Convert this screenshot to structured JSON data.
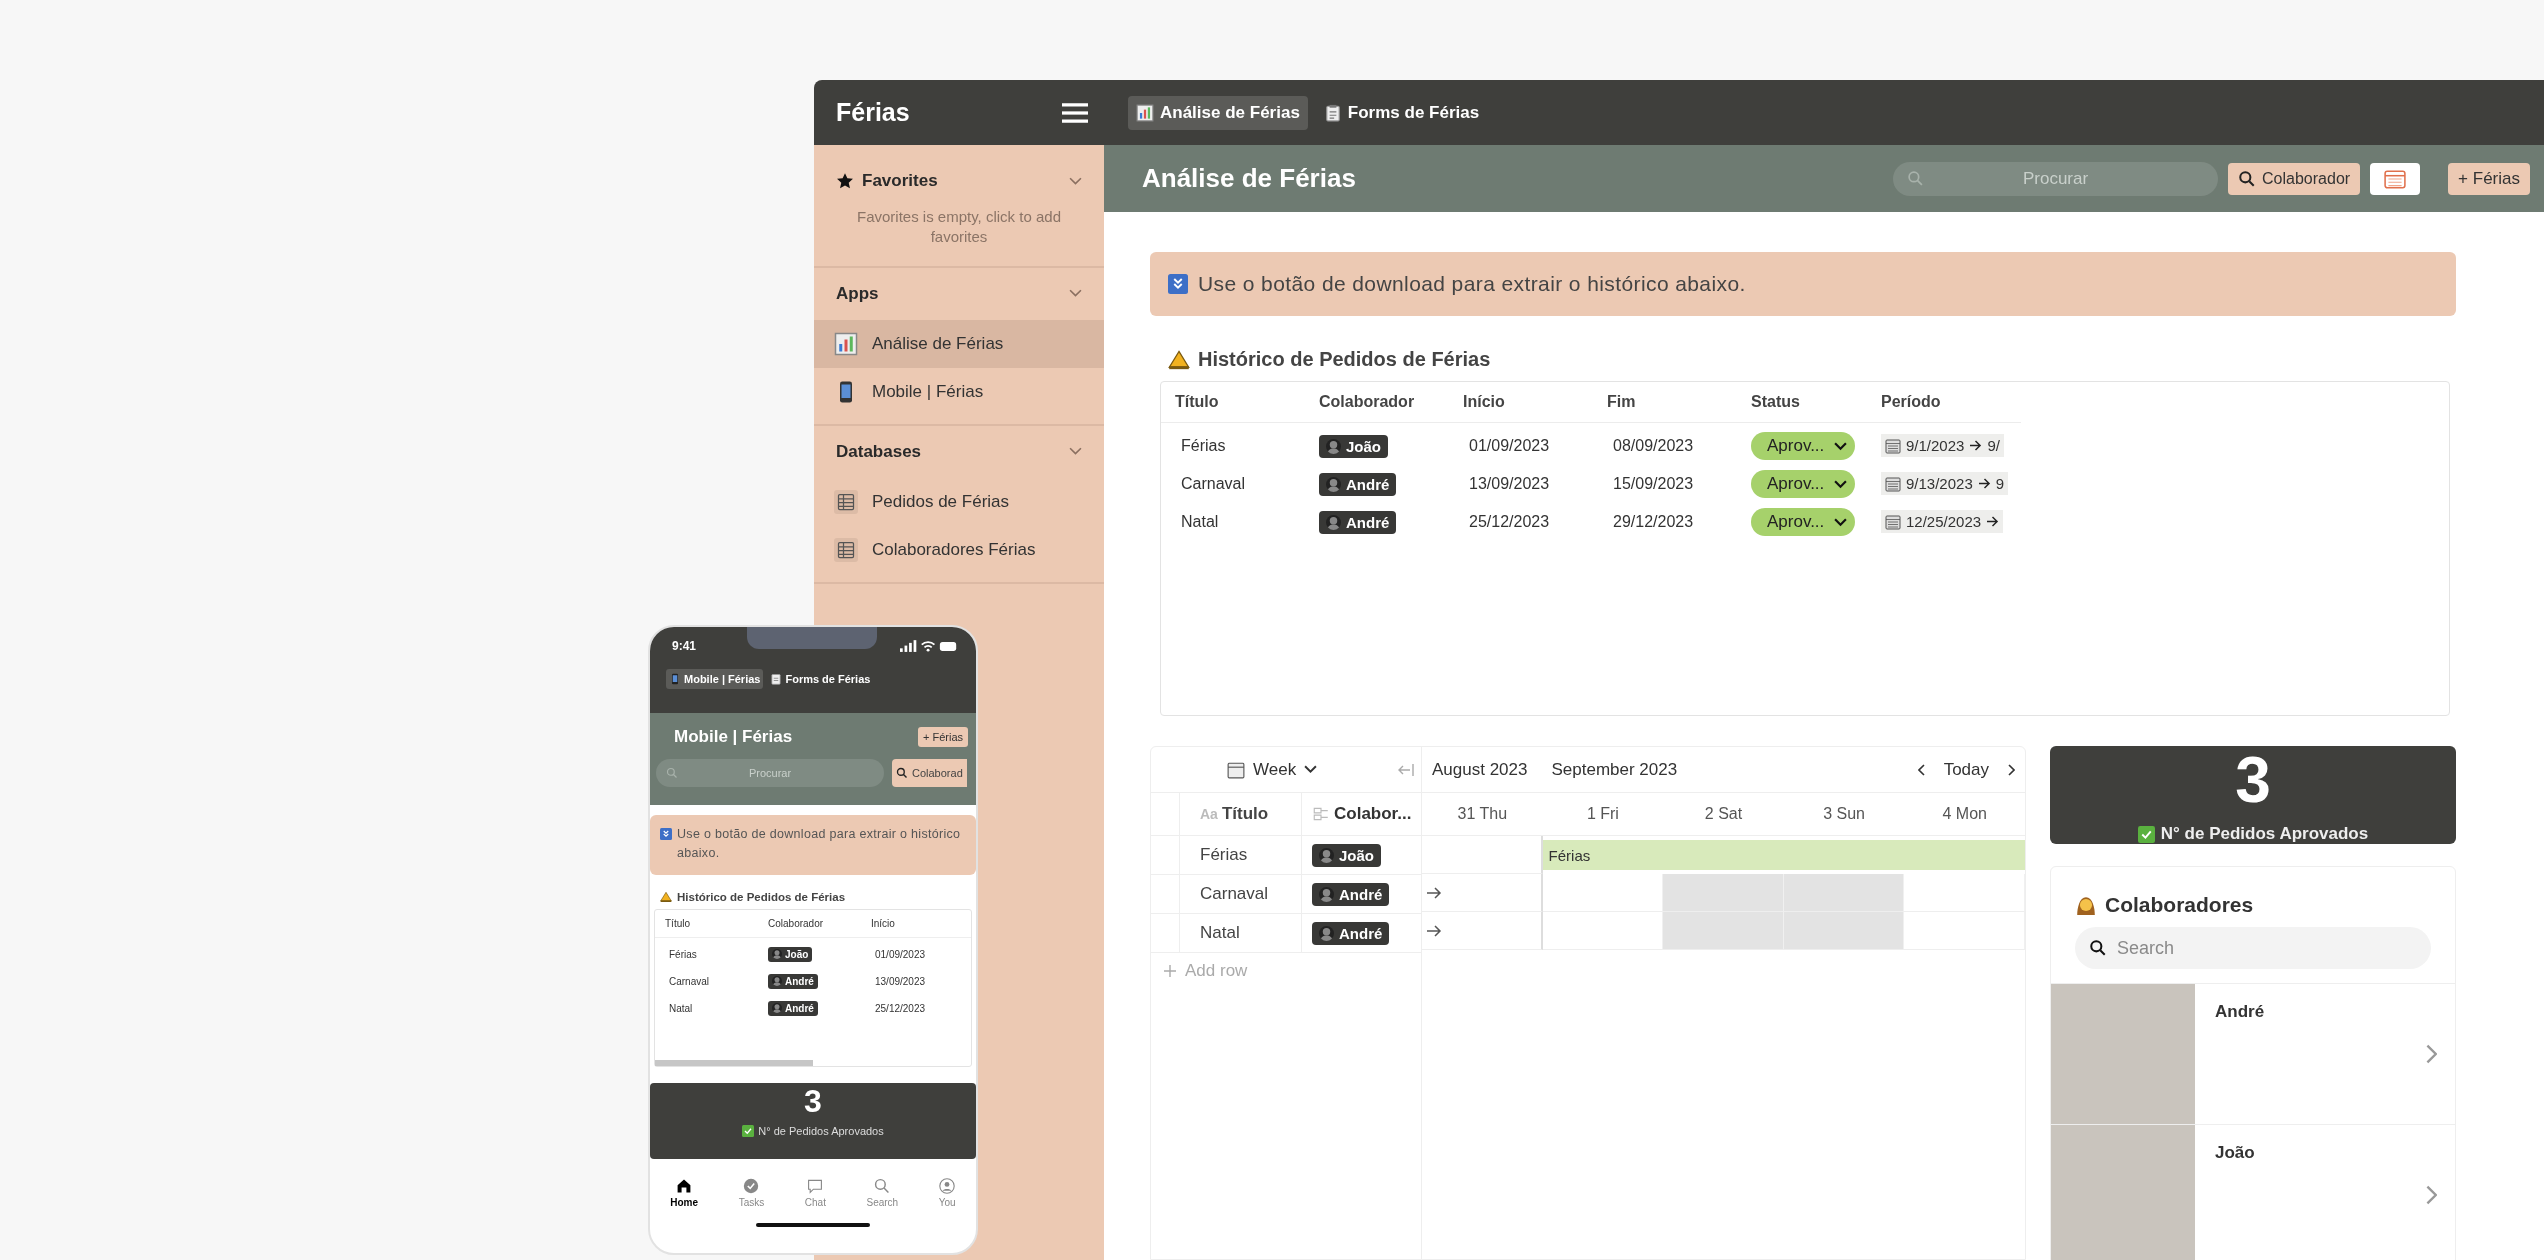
{
  "app": {
    "title": "Férias",
    "tabs": [
      {
        "label": "Análise de Férias",
        "kind": "dashboard",
        "selected": true
      },
      {
        "label": "Forms de Férias",
        "kind": "form",
        "selected": false
      }
    ]
  },
  "sidebar": {
    "sections": [
      {
        "title": "Favorites",
        "kind": "favorites",
        "empty_text": "Favorites is empty, click to add favorites"
      },
      {
        "title": "Apps",
        "kind": "plain",
        "items": [
          {
            "label": "Análise de Férias",
            "kind": "dashboard",
            "selected": true
          },
          {
            "label": "Mobile | Férias",
            "kind": "mobile",
            "selected": false
          }
        ]
      },
      {
        "title": "Databases",
        "kind": "plain",
        "items": [
          {
            "label": "Pedidos de Férias",
            "kind": "database",
            "selected": false
          },
          {
            "label": "Colaboradores Férias",
            "kind": "database",
            "selected": false
          }
        ]
      }
    ]
  },
  "header": {
    "title": "Análise de Férias",
    "search_placeholder": "Procurar",
    "filter_button": "Colaborador",
    "add_button": "+ Férias"
  },
  "callout": "Use o botão de download para extrair o histórico abaixo.",
  "history": {
    "title": "Histórico de Pedidos de Férias",
    "columns": [
      "Título",
      "Colaborador",
      "Início",
      "Fim",
      "Status",
      "Período"
    ],
    "rows": [
      {
        "title": "Férias",
        "person": "João",
        "start": "01/09/2023",
        "end": "08/09/2023",
        "status": "Aprov...",
        "period_start": "9/1/2023",
        "period_end": "9/"
      },
      {
        "title": "Carnaval",
        "person": "André",
        "start": "13/09/2023",
        "end": "15/09/2023",
        "status": "Aprov...",
        "period_start": "9/13/2023",
        "period_end": "9"
      },
      {
        "title": "Natal",
        "person": "André",
        "start": "25/12/2023",
        "end": "29/12/2023",
        "status": "Aprov...",
        "period_start": "12/25/2023"
      }
    ]
  },
  "timeline": {
    "view": "Week",
    "months": [
      "August 2023",
      "September 2023"
    ],
    "today": "Today",
    "type_glyph": "Aa",
    "columns": [
      "Título",
      "Colabor..."
    ],
    "days": [
      {
        "label": "31 Thu",
        "weekend": false
      },
      {
        "label": "1 Fri",
        "weekend": false
      },
      {
        "label": "2 Sat",
        "weekend": true
      },
      {
        "label": "3 Sun",
        "weekend": true
      },
      {
        "label": "4 Mon",
        "weekend": false
      }
    ],
    "rows": [
      {
        "title": "Férias",
        "person": "João",
        "later": false,
        "bar": "Férias",
        "span": [
          false,
          true,
          true,
          true,
          true
        ]
      },
      {
        "title": "Carnaval",
        "person": "André",
        "later": true,
        "span": [
          false,
          false,
          false,
          false,
          false
        ]
      },
      {
        "title": "Natal",
        "person": "André",
        "later": true,
        "span": [
          false,
          false,
          false,
          false,
          false
        ]
      }
    ],
    "add_row": "Add row"
  },
  "stat": {
    "value": "3",
    "label": "N° de Pedidos Aprovados"
  },
  "people": {
    "title": "Colaboradores",
    "search_placeholder": "Search",
    "items": [
      {
        "name": "André"
      },
      {
        "name": "João"
      }
    ]
  },
  "phone": {
    "time": "9:41",
    "tabs": [
      {
        "label": "Mobile | Férias",
        "kind": "mobile",
        "selected": true
      },
      {
        "label": "Forms de Férias",
        "kind": "form",
        "selected": false
      }
    ],
    "title": "Mobile | Férias",
    "add_button": "+ Férias",
    "search_placeholder": "Procurar",
    "filter_button": "Colaborad",
    "callout": "Use o botão de download para extrair o histórico abaixo.",
    "history": {
      "title": "Histórico de Pedidos de Férias",
      "columns": [
        "Título",
        "Colaborador",
        "Início"
      ],
      "rows": [
        {
          "title": "Férias",
          "person": "João",
          "start": "01/09/2023"
        },
        {
          "title": "Carnaval",
          "person": "André",
          "start": "13/09/2023"
        },
        {
          "title": "Natal",
          "person": "André",
          "start": "25/12/2023"
        }
      ]
    },
    "stat": {
      "value": "3",
      "label": "N° de Pedidos Aprovados"
    },
    "nav": [
      {
        "label": "Home",
        "kind": "home",
        "selected": true
      },
      {
        "label": "Tasks",
        "kind": "tasks",
        "selected": false
      },
      {
        "label": "Chat",
        "kind": "chat",
        "selected": false
      },
      {
        "label": "Search",
        "kind": "search",
        "selected": false
      },
      {
        "label": "You",
        "kind": "you",
        "selected": false
      }
    ]
  }
}
